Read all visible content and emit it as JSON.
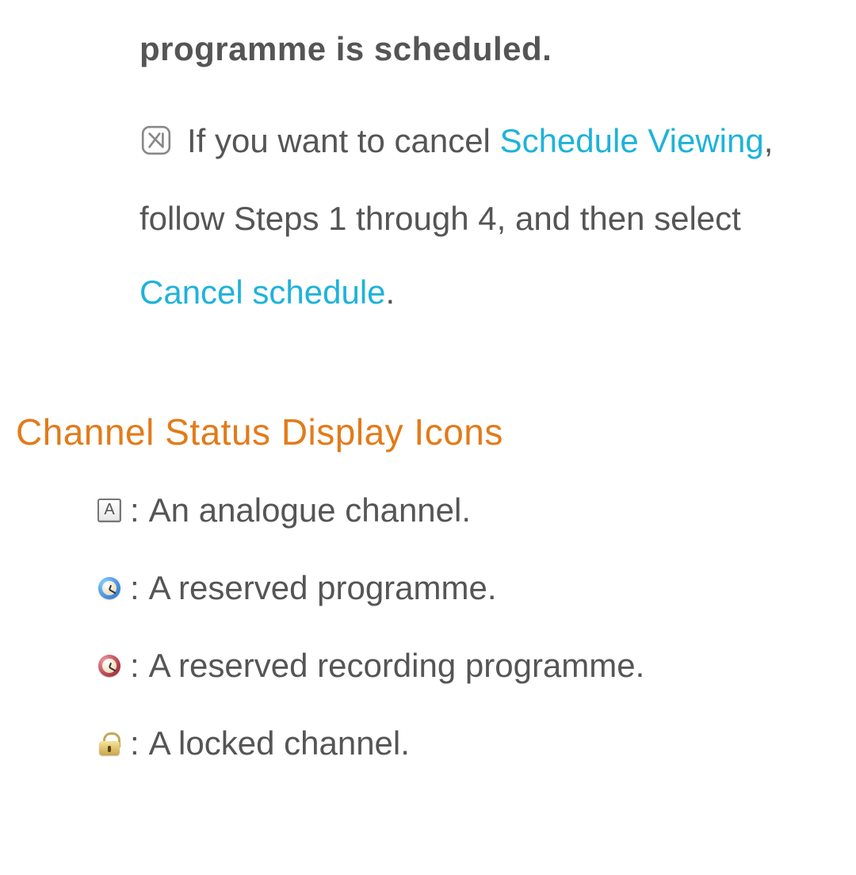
{
  "top_fragment": "programme is scheduled.",
  "note": {
    "pre": "If you want to cancel ",
    "link1": "Schedule Viewing",
    "mid": ", follow Steps 1 through 4, and then select ",
    "link2": "Cancel schedule",
    "post": "."
  },
  "section_heading": "Channel Status Display Icons",
  "icons": {
    "analogue": {
      "letter": "A",
      "desc": "An analogue channel."
    },
    "reserved": {
      "desc": "A reserved programme."
    },
    "recording": {
      "desc": "A reserved recording programme."
    },
    "locked": {
      "desc": "A locked channel."
    }
  }
}
